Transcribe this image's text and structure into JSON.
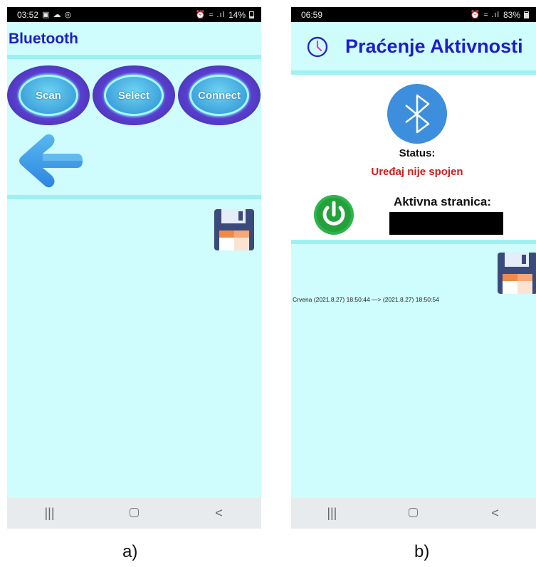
{
  "screen_a": {
    "status_bar": {
      "time": "03:52",
      "icons_left": "▣ ☁ ◎",
      "icons_right": "⏰ ≈ .ıl",
      "battery": "14%"
    },
    "title": "Bluetooth",
    "buttons": {
      "scan": "Scan",
      "select": "Select",
      "connect": "Connect"
    },
    "icons": [
      "back-arrow-icon",
      "save-icon"
    ],
    "nav": {
      "recent": "|||",
      "back": "<"
    },
    "caption": "a)"
  },
  "screen_b": {
    "status_bar": {
      "time": "06:59",
      "icons_right": "⏰ ≈ .ıl",
      "battery": "83%"
    },
    "title": "Praćenje Aktivnosti",
    "status_label": "Status:",
    "status_value": "Uređaj nije spojen",
    "active_page_label": "Aktivna stranica:",
    "active_page_value": "",
    "log": [
      "Crvena   (2021.8.27) 18:50:44  —>  (2021.8.27) 18:50:54"
    ],
    "icons": [
      "clock-icon",
      "bluetooth-icon",
      "power-icon",
      "save-icon"
    ],
    "nav": {
      "recent": "|||",
      "back": "<"
    },
    "caption": "b)"
  },
  "colors": {
    "background": "#cffcfc",
    "divider": "#9ff0f2",
    "title": "#1e1ec8",
    "status_error": "#d21c1c"
  }
}
